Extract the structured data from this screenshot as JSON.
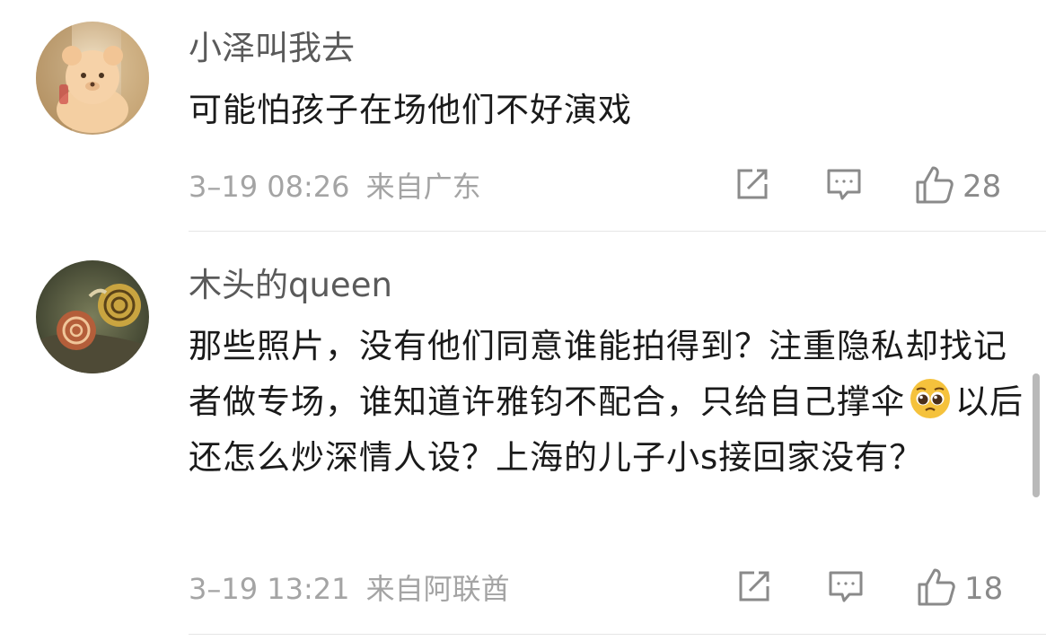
{
  "comments": [
    {
      "username": "小泽叫我去",
      "text_lines": [
        "可能怕孩子在场他们不好演戏"
      ],
      "time": "3–19 08:26",
      "location": "来自广东",
      "likes": "28"
    },
    {
      "username": "木头的queen",
      "text_parts": [
        "那些照片，没有他们同意谁能拍得到？注重隐私却找记者做专场，谁知道许雅钧不配合，只给自己撑伞",
        "以后还怎么炒深情人设？上海的儿子小s接回家没有？"
      ],
      "emoji": "pleading-face",
      "time": "3–19 13:21",
      "location": "来自阿联酋",
      "likes": "18"
    }
  ],
  "colors": {
    "username": "#5a5a5a",
    "text": "#1a1a1a",
    "meta": "#a4a4a4",
    "icon": "#8a8a8a"
  }
}
